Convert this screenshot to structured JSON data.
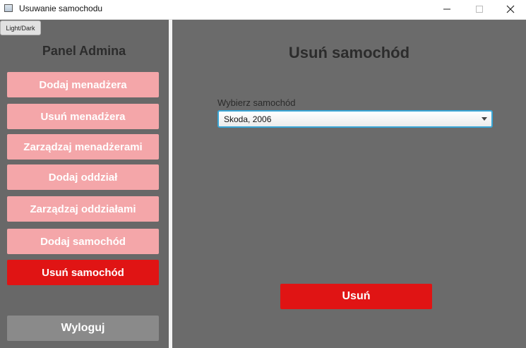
{
  "window": {
    "title": "Usuwanie samochodu"
  },
  "theme_toggle": {
    "label": "Light/Dark"
  },
  "sidebar": {
    "title": "Panel Admina",
    "items": [
      {
        "label": "Dodaj menadżera",
        "active": false
      },
      {
        "label": "Usuń menadżera",
        "active": false
      },
      {
        "label": "Zarządzaj menadżerami",
        "active": false
      },
      {
        "label": "Dodaj oddział",
        "active": false
      },
      {
        "label": "Zarządzaj oddziałami",
        "active": false
      },
      {
        "label": "Dodaj samochód",
        "active": false
      },
      {
        "label": "Usuń samochód",
        "active": true
      }
    ],
    "logout_label": "Wyloguj"
  },
  "main": {
    "title": "Usuń samochód",
    "field_label": "Wybierz samochód",
    "selected_value": "Skoda, 2006",
    "delete_label": "Usuń"
  },
  "colors": {
    "accent_red": "#e01414",
    "button_pink": "#f4a6a9",
    "background": "#686868",
    "focus_blue": "#39a6d6"
  }
}
